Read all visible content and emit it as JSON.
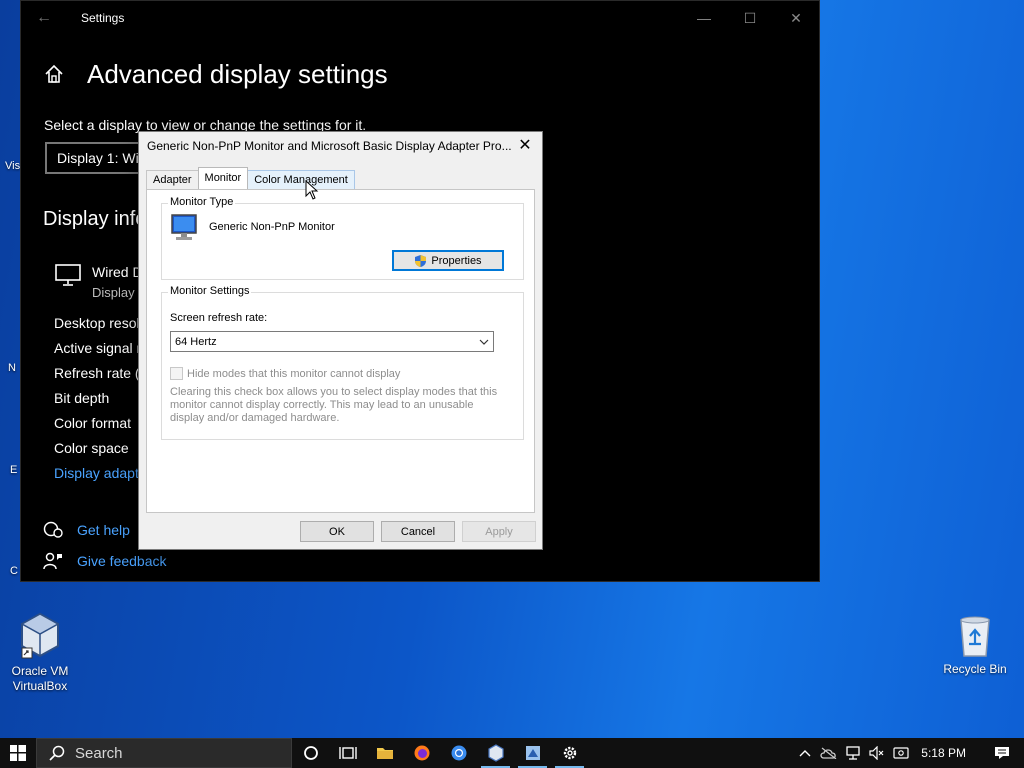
{
  "settings": {
    "window_title": "Settings",
    "page_title": "Advanced display settings",
    "select_label": "Select a display to view or change the settings for it.",
    "display_select_value": "Display 1: Wir",
    "section_title": "Display info",
    "monitor_name": "Wired D",
    "monitor_sub": "Display",
    "info_rows": [
      "Desktop resol",
      "Active signal r",
      "Refresh rate (I",
      "Bit depth",
      "Color format",
      "Color space"
    ],
    "adapter_link": "Display adapt",
    "get_help": "Get help",
    "give_feedback": "Give feedback"
  },
  "dialog": {
    "title": "Generic Non-PnP Monitor and Microsoft Basic Display Adapter Pro...",
    "tabs": [
      "Adapter",
      "Monitor",
      "Color Management"
    ],
    "active_tab": "Monitor",
    "monitor_type_group": "Monitor Type",
    "monitor_type_name": "Generic Non-PnP Monitor",
    "properties_button": "Properties",
    "monitor_settings_group": "Monitor Settings",
    "refresh_label": "Screen refresh rate:",
    "refresh_value": "64 Hertz",
    "hide_modes_label": "Hide modes that this monitor cannot display",
    "hide_modes_help": "Clearing this check box allows you to select display modes that this monitor cannot display correctly. This may lead to an unusable display and/or damaged hardware.",
    "ok_button": "OK",
    "cancel_button": "Cancel",
    "apply_button": "Apply"
  },
  "desktop": {
    "virtualbox_label": "Oracle VM VirtualBox",
    "recycle_bin_label": "Recycle Bin",
    "partial_labels": [
      "Vis",
      "N",
      "E",
      "C"
    ]
  },
  "taskbar": {
    "search_placeholder": "Search",
    "clock": "5:18 PM"
  },
  "colors": {
    "accent": "#0078d7",
    "link": "#4aa3ff",
    "desktop_blue": "#0c56c8"
  }
}
